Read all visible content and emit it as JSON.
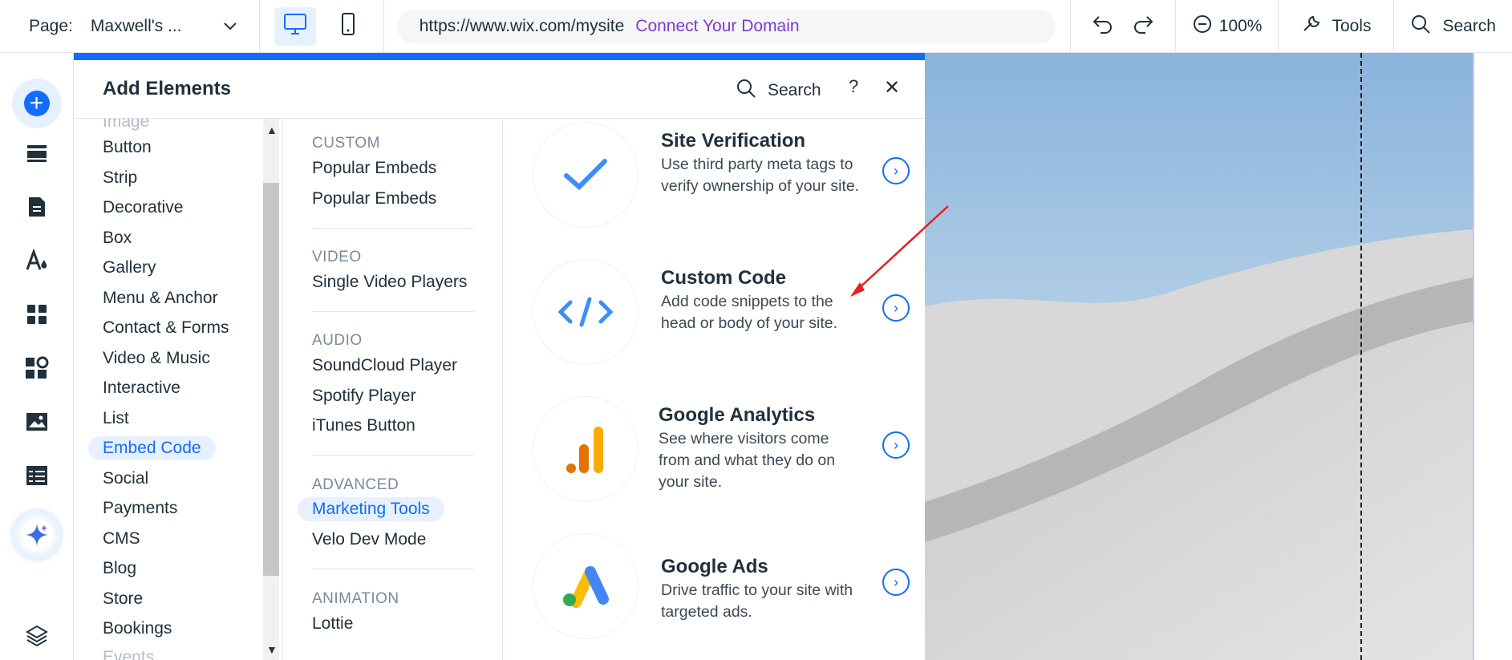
{
  "topbar": {
    "page_label": "Page:",
    "page_value": "Maxwell's ...",
    "url": "https://www.wix.com/mysite",
    "connect_domain": "Connect Your Domain",
    "zoom": "100%",
    "tools": "Tools",
    "search": "Search"
  },
  "panel": {
    "title": "Add Elements",
    "search_label": "Search",
    "help": "?",
    "close": "✕"
  },
  "categories": [
    {
      "label": "Image"
    },
    {
      "label": "Button"
    },
    {
      "label": "Strip"
    },
    {
      "label": "Decorative"
    },
    {
      "label": "Box"
    },
    {
      "label": "Gallery"
    },
    {
      "label": "Menu & Anchor"
    },
    {
      "label": "Contact & Forms"
    },
    {
      "label": "Video & Music"
    },
    {
      "label": "Interactive"
    },
    {
      "label": "List"
    },
    {
      "label": "Embed Code"
    },
    {
      "label": "Social"
    },
    {
      "label": "Payments"
    },
    {
      "label": "CMS"
    },
    {
      "label": "Blog"
    },
    {
      "label": "Store"
    },
    {
      "label": "Bookings"
    },
    {
      "label": "Events"
    }
  ],
  "subsections": {
    "custom": {
      "head": "CUSTOM",
      "items": [
        "Popular Embeds",
        "Popular Embeds"
      ]
    },
    "video": {
      "head": "VIDEO",
      "items": [
        "Single Video Players"
      ]
    },
    "audio": {
      "head": "AUDIO",
      "items": [
        "SoundCloud Player",
        "Spotify Player",
        "iTunes Button"
      ]
    },
    "advanced": {
      "head": "ADVANCED",
      "items": [
        "Marketing Tools",
        "Velo Dev Mode"
      ]
    },
    "animation": {
      "head": "ANIMATION",
      "items": [
        "Lottie"
      ]
    }
  },
  "cards": [
    {
      "title": "Site Verification",
      "desc": "Use third party meta tags to verify ownership of your site.",
      "icon": "checkmark-icon"
    },
    {
      "title": "Custom Code",
      "desc": "Add code snippets to the head or body of your site.",
      "icon": "code-icon"
    },
    {
      "title": "Google Analytics",
      "desc": "See where visitors come from and what they do on your site.",
      "icon": "analytics-icon"
    },
    {
      "title": "Google Ads",
      "desc": "Drive traffic to your site with targeted ads.",
      "icon": "google-ads-icon"
    }
  ],
  "colors": {
    "accent": "#116dff",
    "connect_domain": "#7f3ad8",
    "analytics_orange": "#f9ab00",
    "analytics_dark": "#e37400",
    "ads_blue": "#4285f4",
    "ads_yellow": "#fbbc04",
    "ads_green": "#34a853",
    "annotation_arrow": "#e8201f"
  }
}
